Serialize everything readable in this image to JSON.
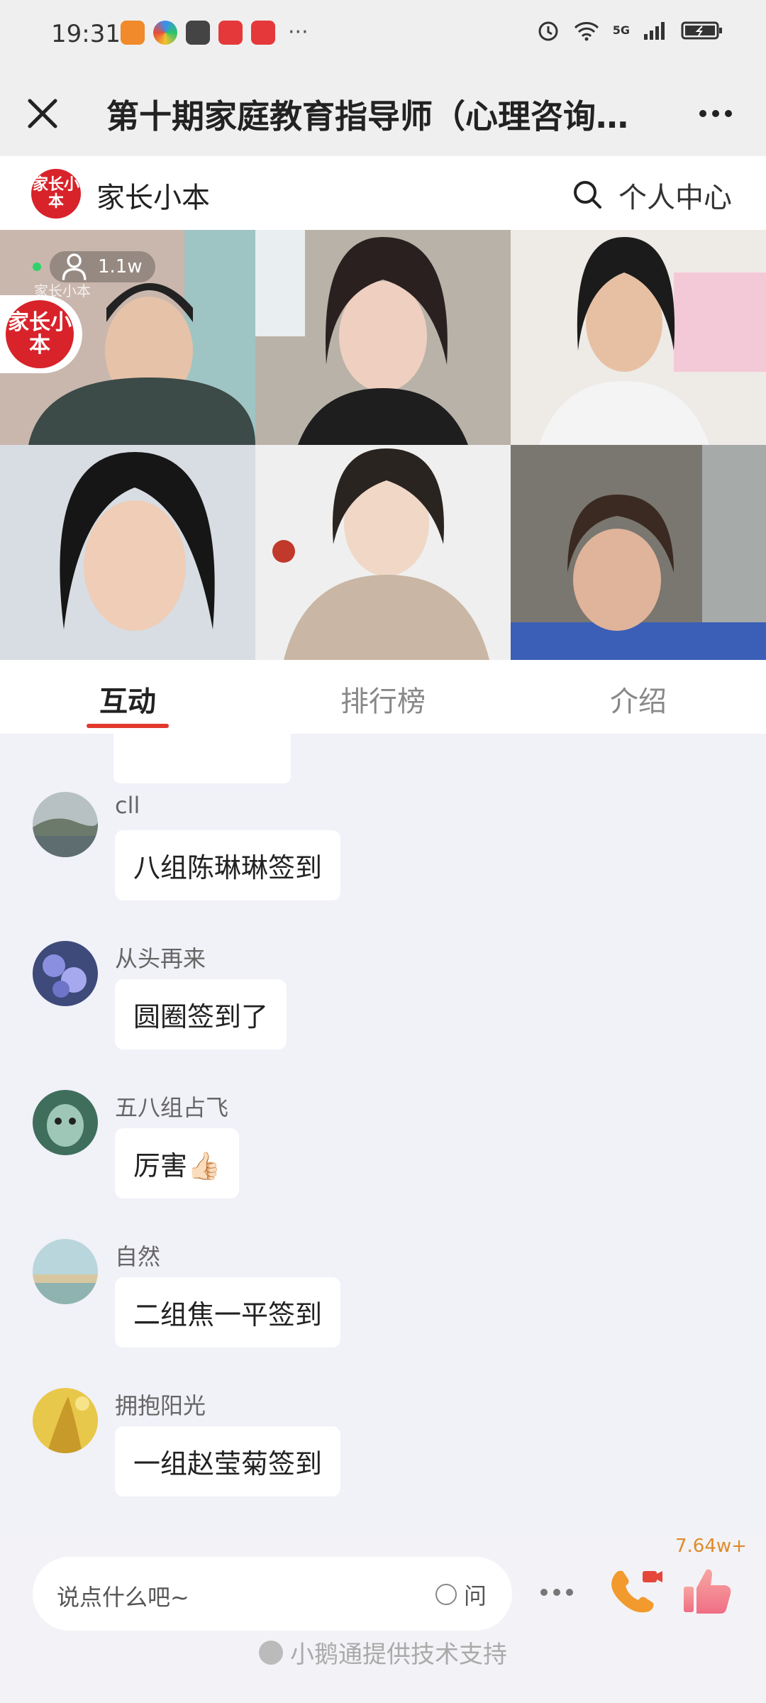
{
  "status_bar": {
    "time": "19:31",
    "more": "···",
    "network": "5G"
  },
  "header": {
    "title": "第十期家庭教育指导师（心理咨询师…"
  },
  "brand": {
    "logo_text": "家长小本",
    "name": "家长小本",
    "personal_center": "个人中心"
  },
  "live": {
    "viewers": "1.1w",
    "watermark": "家长小本"
  },
  "tabs": [
    {
      "label": "互动",
      "active": true
    },
    {
      "label": "排行榜",
      "active": false
    },
    {
      "label": "介绍",
      "active": false
    }
  ],
  "messages": [
    {
      "nickname": "cll",
      "text": "八组陈琳琳签到"
    },
    {
      "nickname": "从头再来",
      "text": "圆圈签到了"
    },
    {
      "nickname": "五八组占飞",
      "text": "厉害👍🏻"
    },
    {
      "nickname": "自然",
      "text": "二组焦一平签到"
    },
    {
      "nickname": "拥抱阳光",
      "text": "一组赵莹菊签到"
    }
  ],
  "input": {
    "placeholder": "说点什么吧~",
    "ask_label": "问"
  },
  "likes": {
    "count": "7.64w+"
  },
  "footer": {
    "note": "小鹅通提供技术支持"
  },
  "colors": {
    "accent": "#e2392f",
    "brand_red": "#d8232a",
    "like_orange": "#e08a2a"
  }
}
